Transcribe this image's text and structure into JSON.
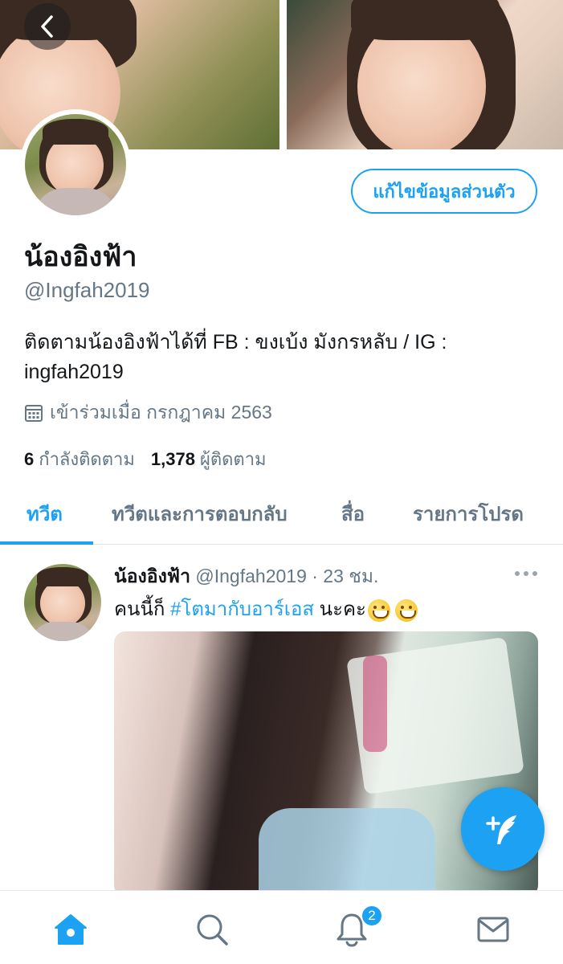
{
  "profile": {
    "display_name": "น้องอิงฟ้า",
    "handle": "@Ingfah2019",
    "bio": "ติดตามน้องอิงฟ้าได้ที่ FB : ขงเบ้ง มังกรหลับ / IG : ingfah2019",
    "joined": "เข้าร่วมเมื่อ กรกฎาคม 2563",
    "following_count": "6",
    "following_label": "กำลังติดตาม",
    "followers_count": "1,378",
    "followers_label": "ผู้ติดตาม",
    "edit_button": "แก้ไขข้อมูลส่วนตัว"
  },
  "tabs": [
    {
      "label": "ทวีต",
      "active": true
    },
    {
      "label": "ทวีตและการตอบกลับ",
      "active": false
    },
    {
      "label": "สื่อ",
      "active": false
    },
    {
      "label": "รายการโปรด",
      "active": false
    }
  ],
  "tweet": {
    "name": "น้องอิงฟ้า",
    "meta": "@Ingfah2019 · 23 ชม.",
    "text_before": "คนนี้ก็ ",
    "hashtag": "#โตมากับอาร์เอส",
    "text_after": " นะคะ",
    "emojis": [
      "grinning-face",
      "grinning-face"
    ]
  },
  "notifications_badge": "2",
  "icons": {
    "back": "chevron-left-icon",
    "calendar": "calendar-icon",
    "more": "more-dots-icon",
    "compose": "compose-tweet-icon",
    "home": "home-icon",
    "search": "search-icon",
    "notifications": "bell-icon",
    "messages": "mail-icon"
  },
  "colors": {
    "accent": "#1da1f2",
    "text_primary": "#14171a",
    "text_secondary": "#657786"
  }
}
